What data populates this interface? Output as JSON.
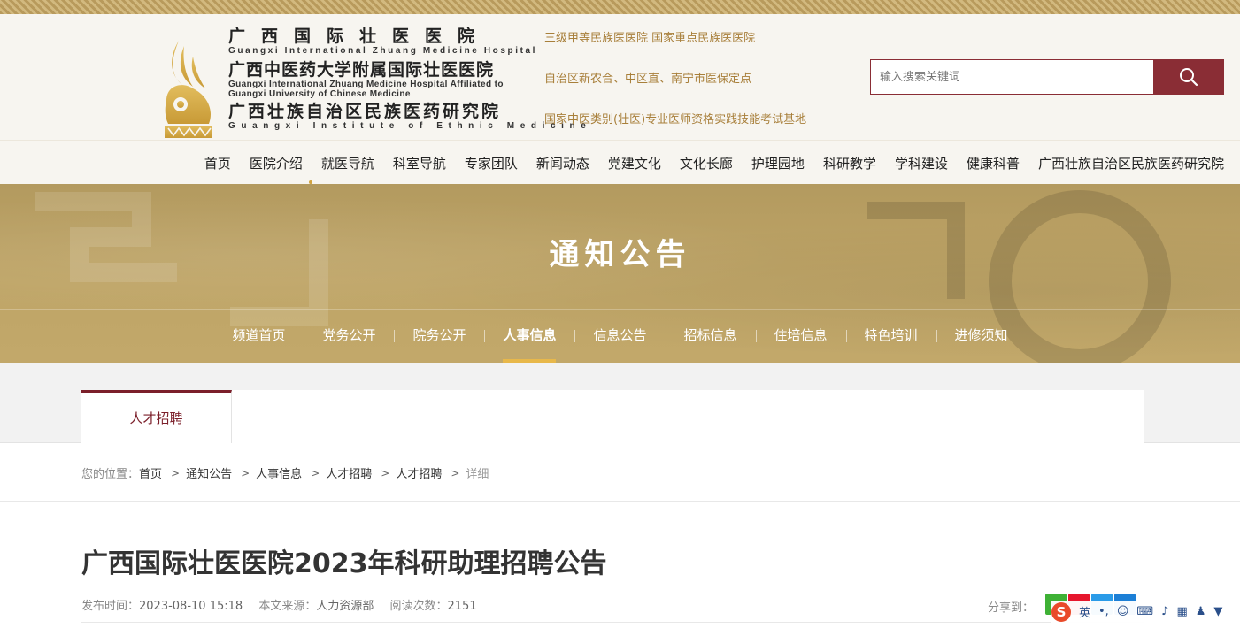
{
  "header": {
    "hospital_names": [
      {
        "cn": "广西国际壮医医院",
        "en": "Guangxi International Zhuang Medicine Hospital"
      },
      {
        "cn": "广西中医药大学附属国际壮医医院",
        "en_line1": "Guangxi International Zhuang Medicine Hospital Affiliated to",
        "en_line2": "Guangxi University of Chinese Medicine"
      },
      {
        "cn": "广西壮族自治区民族医药研究院",
        "en": "Guangxi Institute of Ethnic Medicine"
      }
    ],
    "taglines": [
      "三级甲等民族医医院  国家重点民族医医院",
      "自治区新农合、中区直、南宁市医保定点",
      "国家中医类别(壮医)专业医师资格实践技能考试基地"
    ],
    "search": {
      "placeholder": "输入搜索关键词",
      "icon": "search-icon"
    },
    "brand_color": "#8a2d35",
    "tagline_color": "#a87f3a"
  },
  "nav": {
    "items": [
      "首页",
      "医院介绍",
      "就医导航",
      "科室导航",
      "专家团队",
      "新闻动态",
      "党建文化",
      "文化长廊",
      "护理园地",
      "科研教学",
      "学科建设",
      "健康科普",
      "广西壮族自治区民族医药研究院"
    ]
  },
  "banner": {
    "title": "通知公告",
    "subnav": [
      "频道首页",
      "党务公开",
      "院务公开",
      "人事信息",
      "信息公告",
      "招标信息",
      "住培信息",
      "特色培训",
      "进修须知"
    ],
    "active": "人事信息",
    "accent_color": "#e8b84a"
  },
  "tabs": {
    "active_label": "人才招聘"
  },
  "breadcrumb": {
    "prefix": "您的位置：",
    "items": [
      "首页",
      "通知公告",
      "人事信息",
      "人才招聘",
      "人才招聘",
      "详细"
    ]
  },
  "article": {
    "title": "广西国际壮医医院2023年科研助理招聘公告",
    "publish_label": "发布时间：",
    "publish_time": "2023-08-10 15:18",
    "source_label": "本文来源：",
    "source": "人力资源部",
    "reads_label": "阅读次数：",
    "reads": "2151",
    "share_label": "分享到："
  },
  "ime_toolbar": {
    "mode": "英",
    "punct": "•,",
    "icons": [
      "emoji-icon",
      "keyboard-icon",
      "microphone-icon",
      "grid-icon",
      "user-icon",
      "shirt-icon"
    ]
  }
}
